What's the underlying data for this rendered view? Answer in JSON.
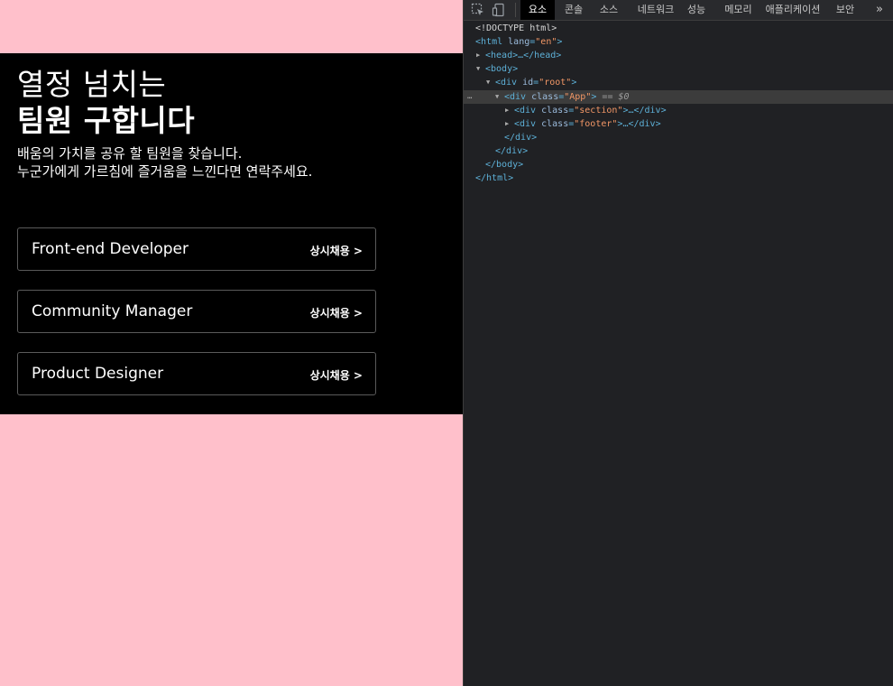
{
  "page": {
    "headline_light": "열정 넘치는",
    "headline_bold": "팀원 구합니다",
    "description_lines": [
      "배움의 가치를 공유 할 팀원을 찾습니다.",
      "누군가에게 가르침에 즐거움을 느낀다면 연락주세요."
    ],
    "jobs": [
      {
        "title": "Front-end Developer",
        "tag": "상시채용 >"
      },
      {
        "title": "Community Manager",
        "tag": "상시채용 >"
      },
      {
        "title": "Product Designer",
        "tag": "상시채용 >"
      }
    ],
    "colors": {
      "background": "#ffc0cb",
      "section": "#000000",
      "text": "#ffffff"
    }
  },
  "devtools": {
    "tabs": [
      "요소",
      "콘솔",
      "소스",
      "네트워크",
      "성능",
      "메모리",
      "애플리케이션",
      "보안"
    ],
    "active_tab": "요소",
    "more_icon": "double-chevron-right-icon",
    "tree": {
      "doctype": "<!DOCTYPE html>",
      "html_tag": "html",
      "html_attr": "lang",
      "html_val": "\"en\"",
      "head": "<head>…</head>",
      "body_open": "<body>",
      "div_root_attr": "id",
      "div_root_val": "\"root\"",
      "app_attr": "class",
      "app_val": "\"App\"",
      "app_ref": "== $0",
      "section_val": "\"section\"",
      "footer_val": "\"footer\"",
      "div_close": "</div>",
      "body_close": "</body>",
      "html_close": "</html>",
      "ellipsis": "…"
    }
  }
}
